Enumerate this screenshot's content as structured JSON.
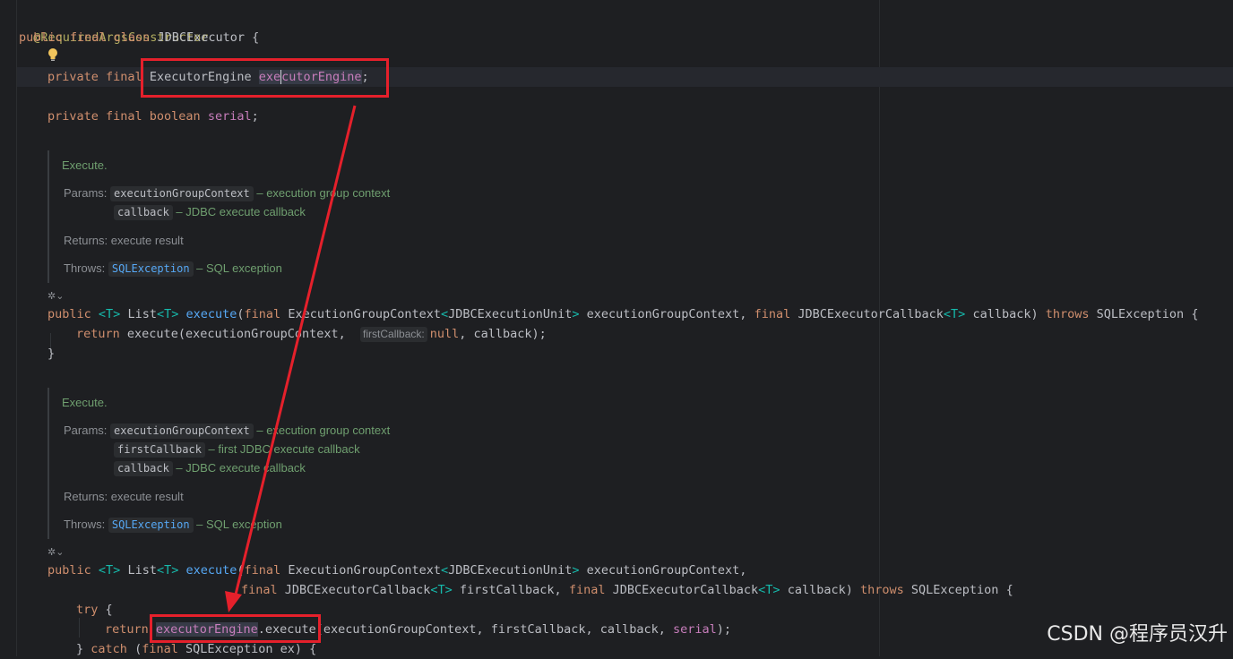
{
  "code": {
    "annotation": "@RequiredArgsConstructor",
    "class_decl": {
      "kw": "public final class",
      "name": "JDBCExecutor",
      "brace": " {"
    },
    "field1": {
      "kw": "private final",
      "type": "ExecutorEngine",
      "name_pre": "exe",
      "name_post": "cutorEngine",
      "semi": ";"
    },
    "field2": {
      "kw": "private final boolean",
      "name": "serial",
      "semi": ";"
    },
    "method1": {
      "kw_public": "public",
      "tparam": "<T>",
      "ret_type": "List",
      "ret_tparam": "<T>",
      "name": "execute",
      "p1_kw": "final",
      "p1_type": "ExecutionGroupContext",
      "p1_gen_open": "<",
      "p1_gen": "JDBCExecutionUnit",
      "p1_gen_close": ">",
      "p1_name": "executionGroupContext,",
      "p2_kw": "final",
      "p2_type": "JDBCExecutorCallback",
      "p2_gen": "<T>",
      "p2_name": "callback)",
      "throws_kw": "throws",
      "exception": "SQLException {",
      "body_return": "return",
      "body_call": "execute(executionGroupContext,",
      "hint": "firstCallback:",
      "body_null": "null",
      "body_rest": ", callback);",
      "close": "}"
    },
    "method2": {
      "kw_public": "public",
      "tparam": "<T>",
      "ret_type": "List",
      "ret_tparam": "<T>",
      "name": "execute",
      "p1_kw": "final",
      "p1_type": "ExecutionGroupContext",
      "p1_gen_open": "<",
      "p1_gen": "JDBCExecutionUnit",
      "p1_gen_close": ">",
      "p1_name": "executionGroupContext,",
      "p2_kw": "final",
      "p2_type": "JDBCExecutorCallback",
      "p2_gen": "<T>",
      "p2_name": "firstCallback,",
      "p3_kw": "final",
      "p3_type": "JDBCExecutorCallback",
      "p3_gen": "<T>",
      "p3_name": "callback)",
      "throws_kw": "throws",
      "exception": "SQLException {",
      "try_kw": "try",
      "try_brace": "{",
      "ret_kw": "return",
      "ret_field": "executorEngine",
      "ret_call": ".execute(executionGroupContext, firstCallback, callback,",
      "ret_serial": "serial",
      "ret_end": ");",
      "catch_close": "}",
      "catch_kw": "catch",
      "catch_open": "(",
      "catch_final": "final",
      "catch_rest": "SQLException ex) {"
    }
  },
  "doc1": {
    "title": "Execute.",
    "params_label": "Params:",
    "param1": "executionGroupContext",
    "param1_desc": " – execution group context",
    "param2": "callback",
    "param2_desc": " – JDBC execute callback",
    "returns": "Returns: execute result",
    "throws_label": "Throws:",
    "throws_type": "SQLException",
    "throws_desc": " – SQL exception"
  },
  "doc2": {
    "title": "Execute.",
    "params_label": "Params:",
    "param1": "executionGroupContext",
    "param1_desc": " – execution group context",
    "param2": "firstCallback",
    "param2_desc": " – first JDBC execute callback",
    "param3": "callback",
    "param3_desc": " – JDBC execute callback",
    "returns": "Returns: execute result",
    "throws_label": "Throws:",
    "throws_type": "SQLException",
    "throws_desc": " – SQL exception"
  },
  "watermark": "CSDN @程序员汉升",
  "colors": {
    "annotation_red": "#e5202b",
    "background": "#1e1f22"
  },
  "icons": [
    "lightbulb-icon",
    "ai-gutter-icon",
    "chevron-down-icon",
    "arrow-annotation"
  ]
}
